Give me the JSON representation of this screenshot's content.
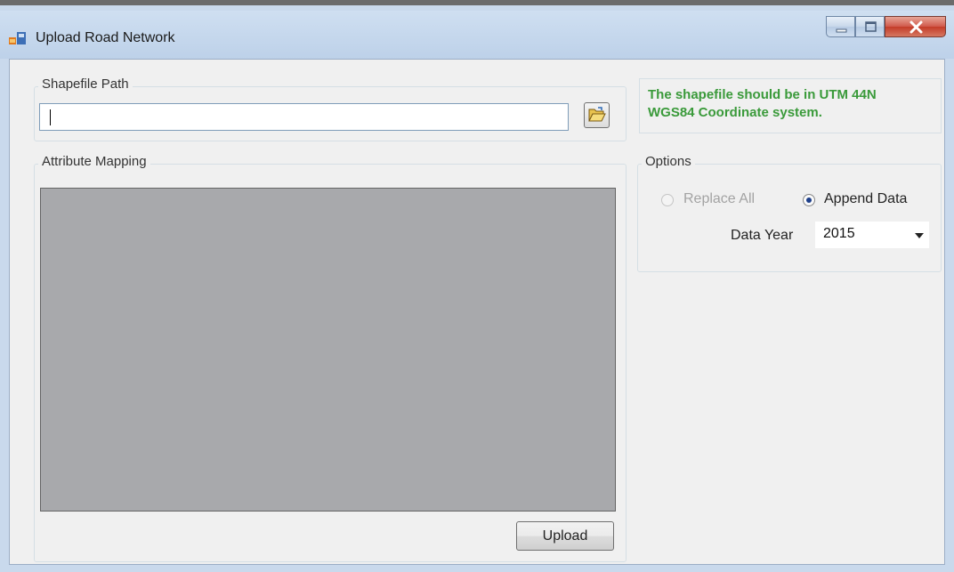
{
  "window": {
    "title": "Upload Road Network"
  },
  "shapefile": {
    "group_label": "Shapefile Path",
    "path_value": ""
  },
  "info": {
    "text": "The shapefile should be in  UTM 44N\nWGS84 Coordinate system."
  },
  "mapping": {
    "group_label": "Attribute Mapping"
  },
  "options": {
    "group_label": "Options",
    "replace_all_label": "Replace All",
    "append_data_label": "Append Data",
    "selected": "Append Data",
    "data_year_label": "Data Year",
    "data_year_value": "2015"
  },
  "actions": {
    "upload_label": "Upload"
  },
  "colors": {
    "info_text": "#3a9a3a",
    "grid_background": "#a8a9ac",
    "close_button": "#c43c28"
  }
}
